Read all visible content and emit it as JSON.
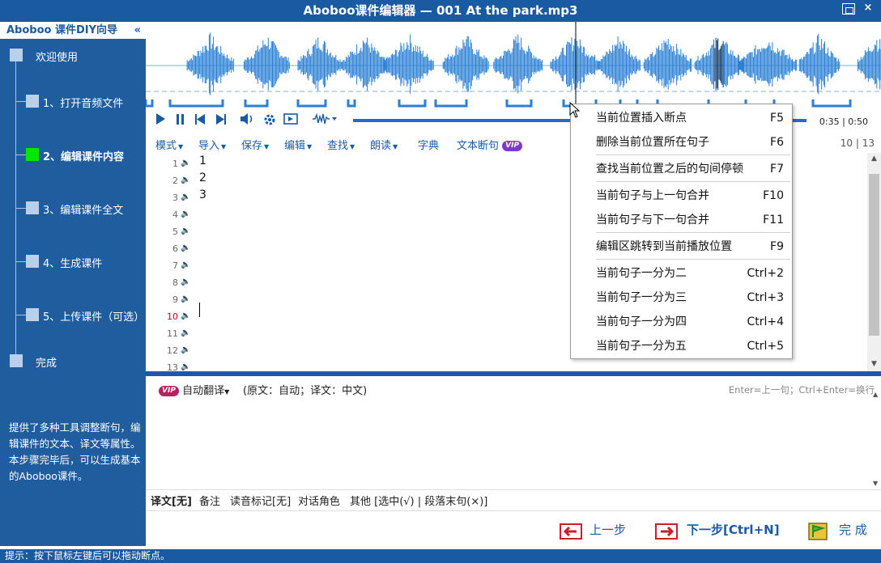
{
  "window": {
    "title": "Aboboo课件编辑器 — 001 At the park.mp3",
    "close_glyph": "×"
  },
  "sidebar": {
    "title": "Aboboo 课件DIY向导",
    "collapse_glyph": "«",
    "steps": [
      {
        "label": "欢迎使用",
        "active": false
      },
      {
        "label": "1、打开音频文件",
        "active": false
      },
      {
        "label": "2、编辑课件内容",
        "active": true
      },
      {
        "label": "3、编辑课件全文",
        "active": false
      },
      {
        "label": "4、生成课件",
        "active": false
      },
      {
        "label": "5、上传课件（可选）",
        "active": false
      },
      {
        "label": "完成",
        "active": false
      }
    ],
    "description": "提供了多种工具调整断句，编辑课件的文本、译文等属性。本步骤完毕后，可以生成基本的Aboboo课件。"
  },
  "player": {
    "time": "0:35 | 0:50",
    "progress": 0.7,
    "icons": [
      "play-icon",
      "pause-icon",
      "skip-back-icon",
      "skip-forward-icon",
      "volume-icon",
      "settings-icon",
      "loop-icon",
      "waveform-icon"
    ]
  },
  "menubar": {
    "items": [
      "模式",
      "导入",
      "保存",
      "编辑",
      "查找",
      "朗读",
      "字典",
      "文本断句"
    ],
    "vip_label": "VIP",
    "page_count": "10 | 13"
  },
  "editor": {
    "lines": [
      {
        "num": "1",
        "text": "1"
      },
      {
        "num": "2",
        "text": "2"
      },
      {
        "num": "3",
        "text": "3"
      },
      {
        "num": "4",
        "text": ""
      },
      {
        "num": "5",
        "text": ""
      },
      {
        "num": "6",
        "text": ""
      },
      {
        "num": "7",
        "text": ""
      },
      {
        "num": "8",
        "text": ""
      },
      {
        "num": "9",
        "text": ""
      },
      {
        "num": "10",
        "text": ""
      },
      {
        "num": "11",
        "text": ""
      },
      {
        "num": "12",
        "text": ""
      },
      {
        "num": "13",
        "text": ""
      }
    ],
    "current_line": "10"
  },
  "context_menu": {
    "items": [
      {
        "label": "当前位置插入断点",
        "key": "F5"
      },
      {
        "label": "删除当前位置所在句子",
        "key": "F6"
      },
      {
        "label": "查找当前位置之后的句间停顿",
        "key": "F7"
      },
      {
        "label": "当前句子与上一句合并",
        "key": "F10"
      },
      {
        "label": "当前句子与下一句合并",
        "key": "F11"
      },
      {
        "label": "编辑区跳转到当前播放位置",
        "key": "F9"
      },
      {
        "label": "当前句子一分为二",
        "key": "Ctrl+2"
      },
      {
        "label": "当前句子一分为三",
        "key": "Ctrl+3"
      },
      {
        "label": "当前句子一分为四",
        "key": "Ctrl+4"
      },
      {
        "label": "当前句子一分为五",
        "key": "Ctrl+5"
      }
    ]
  },
  "translation": {
    "vip_label": "VIP",
    "button": "自动翻译",
    "info": "(原文：自动；译文：中文)",
    "hint": "Enter=上一句；Ctrl+Enter=换行"
  },
  "tabs": [
    "译文[无]",
    "备注",
    "读音标记[无]",
    "对话角色",
    "其他 [选中(√) | 段落末句(×)]"
  ],
  "footer": {
    "prev": "上一步",
    "next": "下一步[Ctrl+N]",
    "finish": "完 成"
  },
  "status": "提示：按下鼠标左键后可以拖动断点。",
  "colors": {
    "accent": "#1a5aa3",
    "sidebar": "#1f5d9f",
    "active_step": "#00e800",
    "wave": "#2a7fd4"
  }
}
